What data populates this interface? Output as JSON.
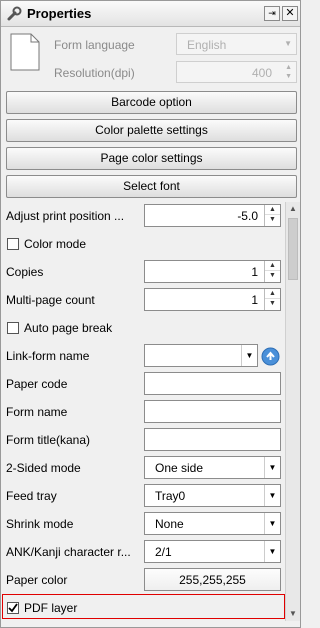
{
  "title": "Properties",
  "header": {
    "pin_glyph": "⇥",
    "close_glyph": "✕"
  },
  "top_fields": {
    "form_language_label": "Form language",
    "form_language_value": "English",
    "resolution_label": "Resolution(dpi)",
    "resolution_value": "400"
  },
  "buttons": {
    "barcode_option": "Barcode option",
    "color_palette": "Color palette settings",
    "page_color": "Page color settings",
    "select_font": "Select font"
  },
  "props": {
    "adjust_print_label": "Adjust print position ...",
    "adjust_print_value": "-5.0",
    "color_mode_label": "Color mode",
    "copies_label": "Copies",
    "copies_value": "1",
    "multipage_label": "Multi-page count",
    "multipage_value": "1",
    "auto_page_break_label": "Auto page break",
    "link_form_label": "Link-form name",
    "paper_code_label": "Paper code",
    "form_name_label": "Form name",
    "form_title_label": "Form title(kana)",
    "two_sided_label": "2-Sided mode",
    "two_sided_value": "One side",
    "feed_tray_label": "Feed tray",
    "feed_tray_value": "Tray0",
    "shrink_label": "Shrink mode",
    "shrink_value": "None",
    "ank_label": "ANK/Kanji character r...",
    "ank_value": "2/1",
    "paper_color_label": "Paper color",
    "paper_color_value": "255,255,255",
    "pdf_layer_label": "PDF layer",
    "pdf_layer_checked": true
  }
}
